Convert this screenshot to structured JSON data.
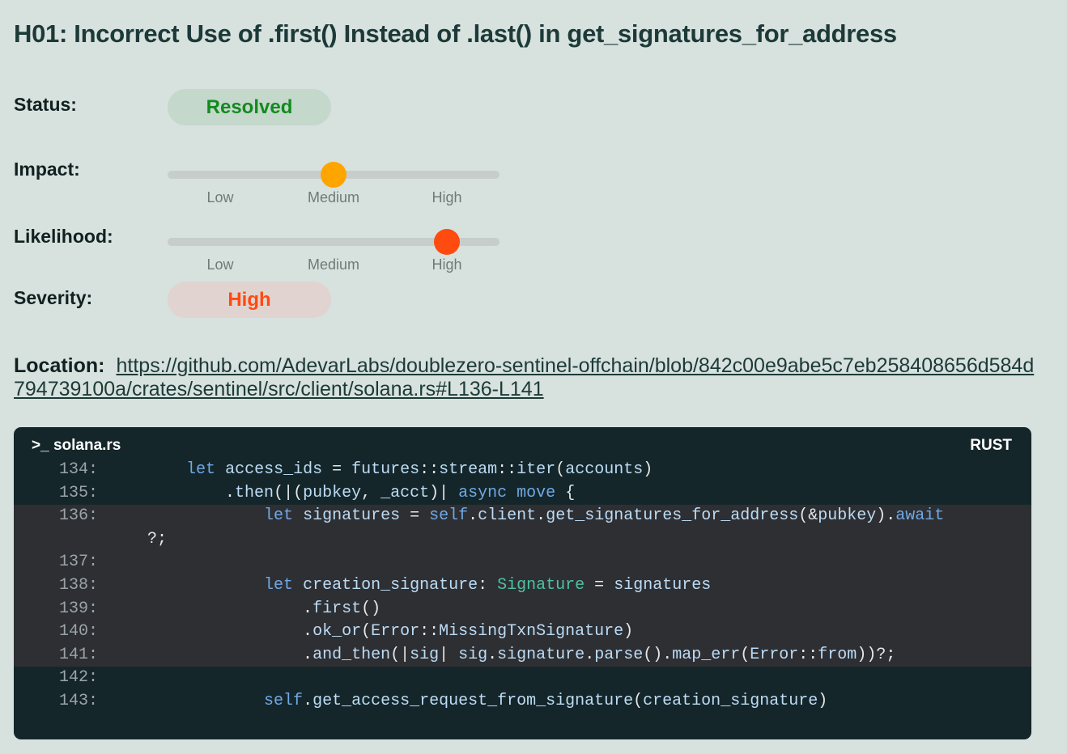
{
  "finding": {
    "title": "H01: Incorrect Use of .first() Instead of .last() in get_signatures_for_address"
  },
  "status": {
    "label": "Status:",
    "value": "Resolved",
    "color": "#138a1e"
  },
  "impact": {
    "label": "Impact:",
    "level": "Medium",
    "ticks": [
      "Low",
      "Medium",
      "High"
    ],
    "color": "#ffa500"
  },
  "likelihood": {
    "label": "Likelihood:",
    "level": "High",
    "ticks": [
      "Low",
      "Medium",
      "High"
    ],
    "color": "#ff4a10"
  },
  "severity": {
    "label": "Severity:",
    "value": "High",
    "color": "#ff4a10"
  },
  "location": {
    "label": "Location:",
    "url": "https://github.com/AdevarLabs/doublezero-sentinel-offchain/blob/842c00e9abe5c7eb258408656d584d794739100a/crates/sentinel/src/client/solana.rs#L136-L141"
  },
  "code": {
    "filename": ">_ solana.rs",
    "language": "RUST",
    "highlight_lines": [
      136,
      141
    ],
    "lines": [
      {
        "num": "134:",
        "text": "        let access_ids = futures::stream::iter(accounts)"
      },
      {
        "num": "135:",
        "text": "            .then(|(pubkey, _acct)| async move {"
      },
      {
        "num": "136:",
        "text": "                let signatures = self.client.get_signatures_for_address(&pubkey).await"
      },
      {
        "num": "",
        "text": "    ?;"
      },
      {
        "num": "137:",
        "text": ""
      },
      {
        "num": "138:",
        "text": "                let creation_signature: Signature = signatures"
      },
      {
        "num": "139:",
        "text": "                    .first()"
      },
      {
        "num": "140:",
        "text": "                    .ok_or(Error::MissingTxnSignature)"
      },
      {
        "num": "141:",
        "text": "                    .and_then(|sig| sig.signature.parse().map_err(Error::from))?;"
      },
      {
        "num": "142:",
        "text": ""
      },
      {
        "num": "143:",
        "text": "                self.get_access_request_from_signature(creation_signature)"
      }
    ]
  }
}
